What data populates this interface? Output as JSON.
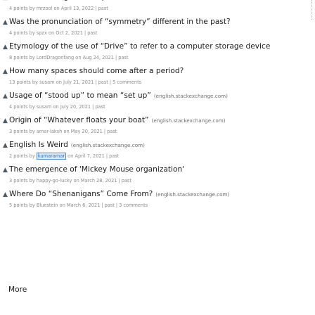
{
  "submissions": [
    {
      "title": "What is the origin of the phrase “time waits for no man”?",
      "domain": "",
      "points": "4 points",
      "user": "mrzool",
      "date": "April 13, 2022",
      "past": "past",
      "comments": ""
    },
    {
      "title": "Was the pronunciation of “symmetry” different in the past?",
      "domain": "",
      "points": "4 points",
      "user": "spzx",
      "date": "Oct 2, 2021",
      "past": "past",
      "comments": ""
    },
    {
      "title": "Etymology of the use of “Drive” to refer to a computer storage device",
      "domain": "",
      "points": "8 points",
      "user": "LordDragonfang",
      "date": "Aug 24, 2021",
      "past": "past",
      "comments": ""
    },
    {
      "title": "How many spaces should come after a period?",
      "domain": "",
      "points": "13 points",
      "user": "susam",
      "date": "July 21, 2021",
      "past": "past",
      "comments": "5 comments"
    },
    {
      "title": "Usage of “stood up” to mean “set up”",
      "domain": "(english.stackexchange.com)",
      "points": "4 points",
      "user": "susam",
      "date": "July 20, 2021",
      "past": "past",
      "comments": ""
    },
    {
      "title": "Origin of “Whatever floats your boat”",
      "domain": "(english.stackexchange.com)",
      "points": "3 points",
      "user": "amar-laksh",
      "date": "May 20, 2021",
      "past": "past",
      "comments": ""
    },
    {
      "title": "English Is Weird",
      "domain": "(english.stackexchange.com)",
      "points": "2 points",
      "user": "kumaramar",
      "user_boxed": true,
      "date": "April 7, 2021",
      "past": "past",
      "comments": ""
    },
    {
      "title": "The emergence of 'Mickey Mouse organization'",
      "domain": "",
      "points": "3 points",
      "user": "happy-go-lucky",
      "date": "March 28, 2021",
      "past": "past",
      "comments": ""
    },
    {
      "title": "Where Do “Shenanigans” Come From?",
      "domain": "(english.stackexchange.com)",
      "points": "5 points",
      "user": "Bluestein",
      "date": "March 6, 2021",
      "past": "past",
      "comments": "3 comments"
    }
  ],
  "labels": {
    "by": "by",
    "on": "on",
    "sep": "|",
    "more": "More"
  },
  "icons": {
    "upvote": "upvote-arrow-icon"
  },
  "colors": {
    "highlight_border": "#4a8fd0",
    "highlight_bg": "#dce9f7"
  }
}
